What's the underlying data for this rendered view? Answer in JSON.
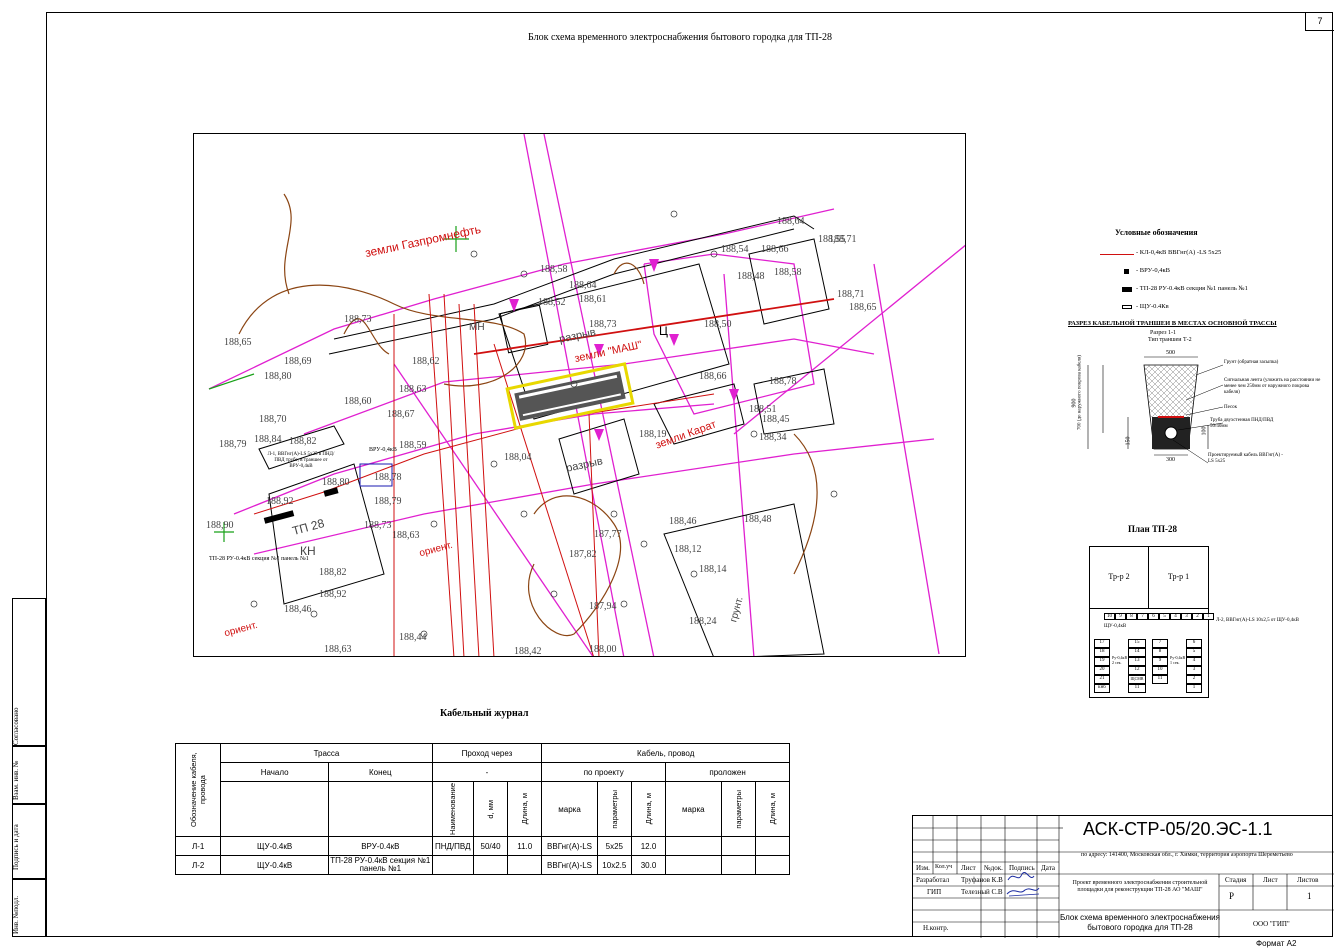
{
  "sheet_number": "7",
  "title": "Блок схема временного электроснабжения бытового городка для ТП-28",
  "side_labels": [
    "Согласовано",
    "Взам. инв. №",
    "Подпись и дата",
    "Инв. №подл."
  ],
  "plan": {
    "labels": [
      "188,64",
      "188,55",
      "188,66",
      "188,58",
      "188,54",
      "188,48",
      "188,71",
      "188,65",
      "188,61",
      "188,64",
      "188,58",
      "188,52",
      "188,73",
      "188,50",
      "188,65",
      "188,69",
      "188,80",
      "188,73",
      "188,80",
      "188,62",
      "188,60",
      "188,63",
      "188,67",
      "188,74",
      "188,70",
      "188,82",
      "188,84",
      "188,79",
      "188,59",
      "188,78",
      "188,80",
      "188,79",
      "188,92",
      "188,80",
      "188,73",
      "188,63",
      "188,90",
      "188,82",
      "188,92",
      "188,46",
      "188,63",
      "188,44",
      "188,42",
      "188,00",
      "188,18",
      "188,24",
      "188,14",
      "188,12",
      "188,46",
      "188,48",
      "188,28",
      "188,51",
      "188,45",
      "188,34",
      "188,19",
      "188,04",
      "187,77",
      "187,82",
      "187,94",
      "187,95",
      "187,86",
      "188,21",
      "188,17",
      "188,71",
      "188,78",
      "188,66",
      "188,63",
      "188,29",
      "188,21"
    ],
    "text_labels": [
      "земли Газпромнефть",
      "разрыв",
      "земли \"МАШ\"",
      "разрыв",
      "земли Карат",
      "ТП 28",
      "КН",
      "МН",
      "Ц",
      "грунт.",
      "ориент.",
      "ориент."
    ],
    "callouts": [
      "ВРУ-0,4кВ",
      "Л-1, ВВГнг(А)-LS 5х25 в ПНД/ПВД трубе, в траншее от ВРУ-0,4кВ",
      "ТП-28 РУ-0.4кВ секция №1 панель №1"
    ]
  },
  "legend": {
    "title": "Условные обозначения",
    "items": [
      "- КЛ-0,4кВ ВВГнг(А) -LS 5х25",
      "- ВРУ-0,4кВ",
      "- ТП-28 РУ-0.4кВ секция №1 панель №1",
      "- ЩУ-0.4Кв"
    ]
  },
  "section": {
    "title": "РАЗРЕЗ КАБЕЛЬНОЙ ТРАНШЕИ В МЕСТАХ ОСНОВНОЙ ТРАССЫ",
    "subtitle1": "Разрез 1-1",
    "subtitle2": "Тип траншеи Т-2",
    "dim_top": "500",
    "dim_bottom": "300",
    "dim_left": "900",
    "dim_left_text": "700 (до наружного покрова кабеля)",
    "dim_150": "150",
    "dim_100": "100",
    "notes": [
      "Грунт (обратная засыпка)",
      "Сигнальная лента (уложить на расстоянии не менее чем 250мм от наружного покрова кабеля)",
      "Песок",
      "Труба двухстенная ПНД/ПВД 50/40мм",
      "Проектируемый кабель ВВГнг(А) -LS 5х25"
    ]
  },
  "tp_plan": {
    "title": "План ТП-28",
    "tr1": "Тр-р 1",
    "tr2": "Тр-р 2",
    "panel_numbers": [
      "10",
      "9",
      "8",
      "7",
      "6",
      "5",
      "4",
      "3",
      "2",
      "1"
    ],
    "label_shu": "ЩУ-0,4кВ",
    "cable_note": "Л-2, ВВГнг(А)-LS 10х2,5 от ЩУ-0,4кВ",
    "left_cells": [
      "17",
      "18",
      "19",
      "20",
      "21",
      "кнб"
    ],
    "left_mid_cells": [
      "15",
      "14",
      "13",
      "12",
      "ЩСМВ",
      "11"
    ],
    "left_mid_label": "Ру-0,4кВ 2 сек.",
    "right_mid_cells": [
      "7",
      "8",
      "9",
      "10",
      "11"
    ],
    "right_mid_label": "Ру-0,4кВ 1 сек.",
    "right_cells": [
      "6",
      "5",
      "4",
      "3",
      "2",
      "1"
    ]
  },
  "cable_journal": {
    "title": "Кабельный журнал",
    "headers": {
      "designation": "Обозначение кабеля, провода",
      "route": "Трасса",
      "start": "Начало",
      "end": "Конец",
      "pass": "Проход через",
      "pass_dash": "-",
      "cable": "Кабель, провод",
      "by_project": "по проекту",
      "laid": "проложен",
      "name": "Наименование",
      "d": "d, мм",
      "length": "Длина, м",
      "mark": "марка",
      "params": "параметры",
      "length2": "Длина, м",
      "mark2": "марка",
      "params2": "параметры",
      "length3": "Длина, м"
    },
    "rows": [
      {
        "id": "Л-1",
        "start": "ЩУ-0.4кВ",
        "end": "ВРУ-0.4кВ",
        "name": "ПНД/ПВД",
        "d": "50/40",
        "len": "11.0",
        "mark": "ВВГнг(А)-LS",
        "params": "5х25",
        "plen": "12.0"
      },
      {
        "id": "Л-2",
        "start": "ЩУ-0.4кВ",
        "end": "ТП-28 РУ-0.4кВ секция №1 панель №1",
        "name": "",
        "d": "",
        "len": "",
        "mark": "ВВГнг(А)-LS",
        "params": "10х2.5",
        "plen": "30.0"
      }
    ]
  },
  "stamp": {
    "code": "АСК-СТР-05/20.ЭС-1.1",
    "address": "по адресу: 141400, Московская обл., г. Химки, территория аэропорта Шереметьево",
    "col_headers": [
      "Изм.",
      "Кол.уч",
      "Лист",
      "№док.",
      "Подпись",
      "Дата"
    ],
    "roles": [
      "Разработал",
      "ГИП",
      "",
      "",
      "Н.контр."
    ],
    "names": [
      "Труфанов К.В",
      "Телезный С.В",
      "",
      "",
      ""
    ],
    "project": "Проект временного электроснабжения строительной площадки для реконструкции ТП-28 АО \"МАШ\"",
    "stage_h": "Стадия",
    "sheet_h": "Лист",
    "sheets_h": "Листов",
    "stage": "Р",
    "sheets": "1",
    "drawing_title": "Блок схема временного электроснабжения бытового городка для ТП-28",
    "company": "ООО \"ГИП\"",
    "format": "Формат А2"
  }
}
